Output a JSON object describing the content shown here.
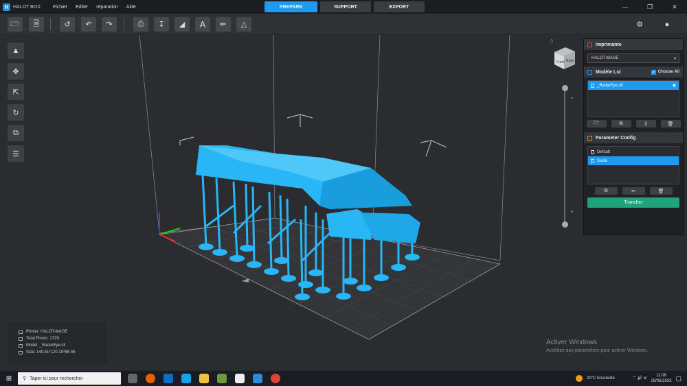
{
  "app": {
    "title": "HALOT BOX",
    "logo_letter": "H"
  },
  "menu": [
    "Fichier",
    "Editer",
    "réparation",
    "Aide"
  ],
  "mode_tabs": [
    "PREPARE",
    "SUPPORT",
    "EXPORT"
  ],
  "window_controls": [
    "minimize-icon",
    "maximize-icon",
    "close-icon"
  ],
  "toolbar_icons": [
    "open-folder-icon",
    "open-file-icon",
    "history-icon",
    "undo-icon",
    "redo-icon",
    "printer-icon",
    "export-icon",
    "mirror-icon",
    "text-icon",
    "ruler-icon",
    "eraser-icon",
    "settings-gear-icon",
    "user-icon"
  ],
  "left_tools": [
    "auto-arrange-icon",
    "move-icon",
    "scale-icon",
    "rotate-icon",
    "duplicate-icon",
    "list-icon"
  ],
  "view_cube": {
    "front": "Front",
    "right": "Right"
  },
  "printer": {
    "header": "Imprimante",
    "selected": "HALOT-MAGE"
  },
  "models": {
    "header": "Modèle Lst",
    "choose_all": "Choose All",
    "items": [
      "_RadarEye.stl"
    ]
  },
  "params": {
    "header": "Parameter Config",
    "items": [
      "Default",
      "Sunlu"
    ]
  },
  "slice_button": "Trancher",
  "info": {
    "printer": "Printer: HALOT-MAGE",
    "floors": "Total Floors: 1729",
    "model": "Model: _RadarEye.stl",
    "size": "Size: 149.51*120.10*86.45"
  },
  "activate_windows": {
    "title": "Activer Windows",
    "subtitle": "Accédez aux paramètres pour activer Windows."
  },
  "taskbar": {
    "search_placeholder": "Taper ici pour rechercher",
    "weather": "20°C  Ensoleillé",
    "time": "11:08",
    "date": "29/05/2023"
  },
  "colors": {
    "accent": "#1e9bf0",
    "slice": "#1ea37a",
    "model": "#29b6f6"
  }
}
